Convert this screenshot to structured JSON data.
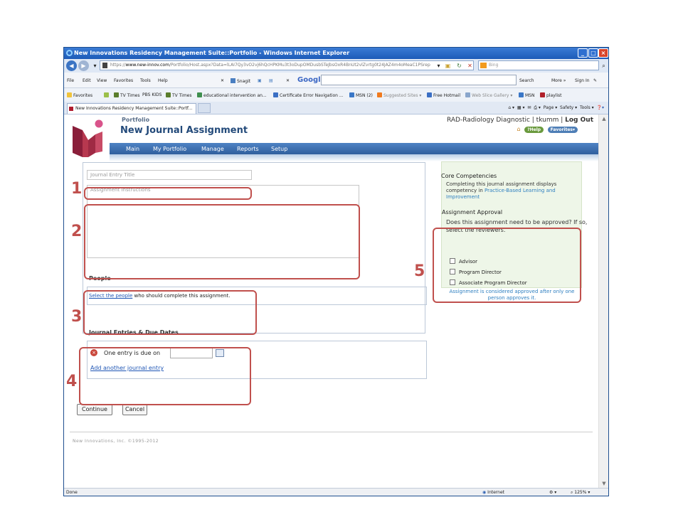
{
  "browser": {
    "title": "New Innovations Residency Management Suite::Portfolio - Windows Internet Explorer",
    "url_scheme": "https",
    "url_host": "www.new-innov.com",
    "url_rest": "/Portfolio/Host.aspx?Data=lLAI7Qy3vO2vj6hQcHPKMu3t3oDupOMDusbSTeJbsOxR4BnUt2vlZvrtg0t24JAZ4m4oMeaC1PSrep",
    "bing_placeholder": "Bing",
    "menus": [
      "File",
      "Edit",
      "View",
      "Favorites",
      "Tools",
      "Help"
    ],
    "snagit": "Snagit",
    "google_logo": "Google",
    "toolbar_right": [
      "Search",
      "More »",
      "Sign In"
    ],
    "favorites_label": "Favorites",
    "favorites": [
      "TV Times",
      "PBS KIDS",
      "TV Times",
      "educational intervention an...",
      "Certificate Error Navigation ...",
      "MSN (2)",
      "Suggested Sites",
      "Free Hotmail",
      "Web Slice Gallery",
      "MSN",
      "playlist"
    ],
    "tab_label": "New Innovations Residency Management Suite::Portf...",
    "command_bar": [
      "Page",
      "Safety",
      "Tools"
    ],
    "status_left": "Done",
    "status_zone": "Internet",
    "status_zoom": "125%"
  },
  "header": {
    "section": "Portfolio",
    "title": "New Journal Assignment",
    "user_info": "RAD-Radiology Diagnostic | tkumm | ",
    "logout": "Log Out",
    "help_button": "?Help",
    "favorites_button": "Favorites",
    "nav": [
      "Main",
      "My Portfolio",
      "Manage",
      "Reports",
      "Setup"
    ]
  },
  "form": {
    "title_placeholder": "Journal Entry Title",
    "instructions_placeholder": "Assignment Instructions",
    "people_title": "People",
    "people_link": "Select the people",
    "people_text": " who should complete this assignment.",
    "entries_title": "Journal Entries & Due Dates",
    "entry_text": "One entry is due on",
    "entry_remove_icon": "×",
    "add_entry": "Add another journal entry",
    "continue_button": "Continue",
    "cancel_button": "Cancel"
  },
  "competencies": {
    "title": "Core Competencies",
    "text_prefix": "Completing this journal assignment displays competency in ",
    "text_link": "Practice-Based Learning and Improvement"
  },
  "approval": {
    "title": "Assignment Approval",
    "question": "Does this assignment need to be approved? If so, select the reviewers.",
    "options": [
      "Advisor",
      "Program Director",
      "Associate Program Director"
    ],
    "note": "Assignment is considered approved after only one person approves it."
  },
  "footer": {
    "copyright": "New Innovations, Inc. ©1995-2012"
  },
  "annotations": [
    "1",
    "2",
    "3",
    "4",
    "5"
  ],
  "colors": {
    "annotation": "#c0504d",
    "nav_bar": "#3b6fae",
    "link": "#1f56b5",
    "competency_panel": "#eef6e8"
  }
}
